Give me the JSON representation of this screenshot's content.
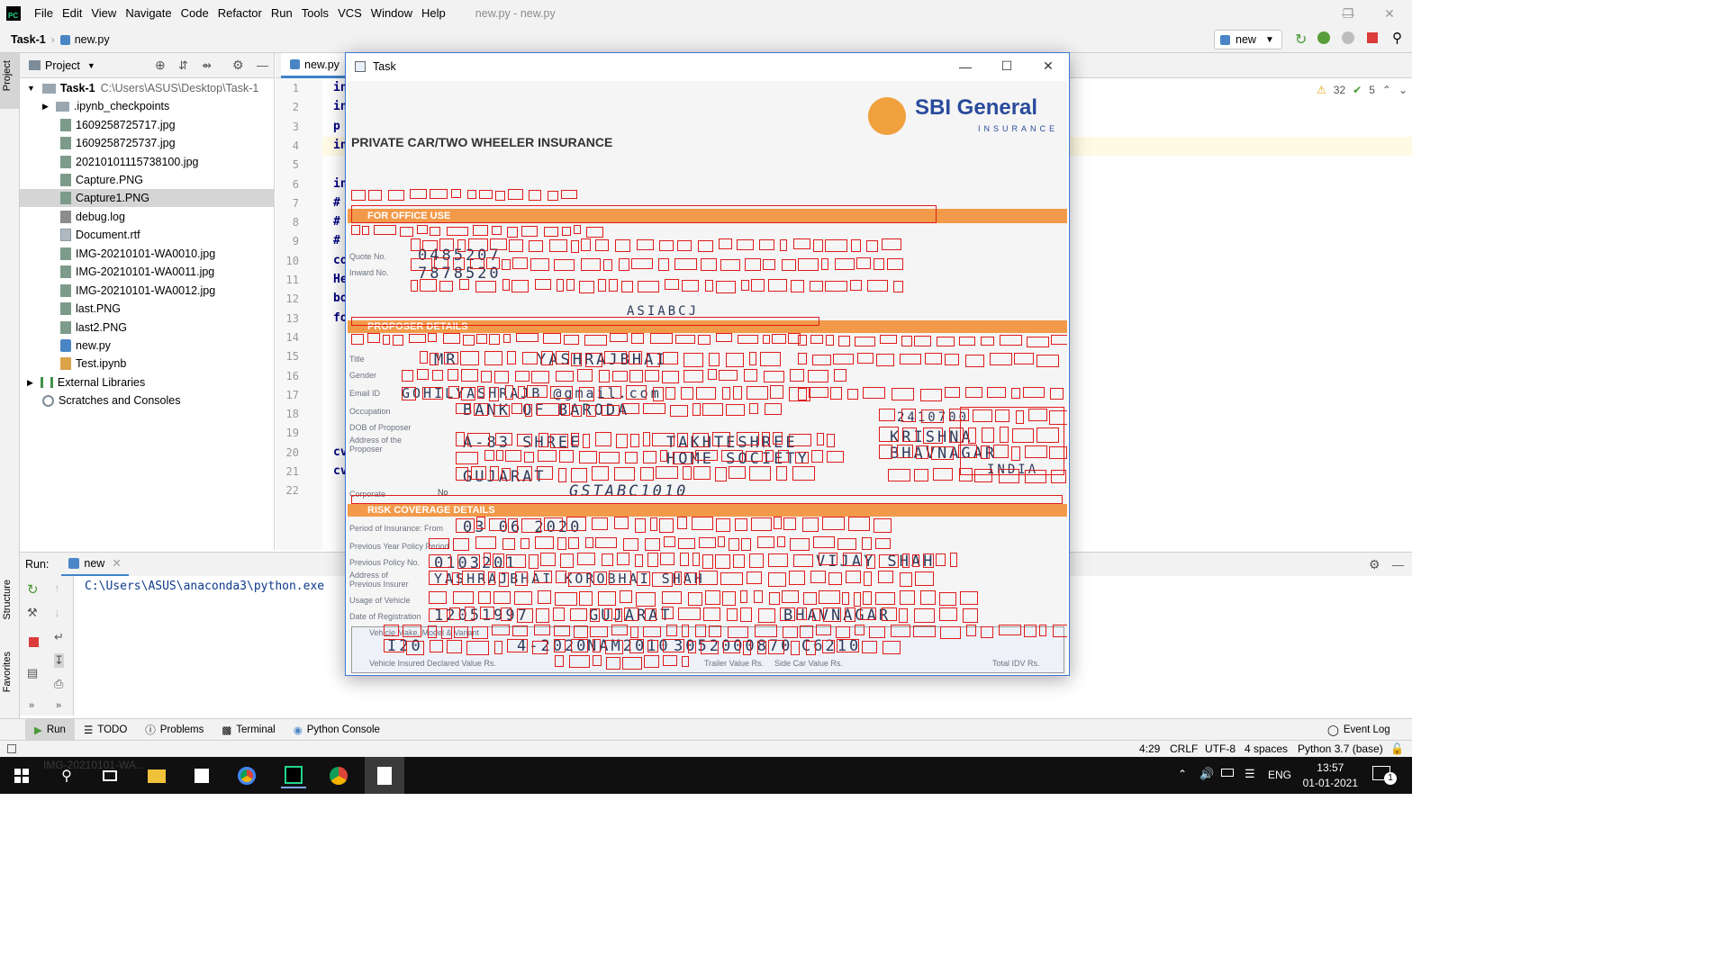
{
  "menubar": {
    "logo_text": "PC",
    "items": [
      "File",
      "Edit",
      "View",
      "Navigate",
      "Code",
      "Refactor",
      "Run",
      "Tools",
      "VCS",
      "Window",
      "Help"
    ],
    "window_title": "new.py - new.py"
  },
  "navbar": {
    "project": "Task-1",
    "file": "new.py",
    "run_config": "new"
  },
  "left_stripe": {
    "project_tab": "Project",
    "structure_tab": "Structure",
    "favorites_tab": "Favorites"
  },
  "project_panel": {
    "title": "Project",
    "root_name": "Task-1",
    "root_path": "C:\\Users\\ASUS\\Desktop\\Task-1",
    "items": [
      {
        "label": ".ipynb_checkpoints",
        "icon": "folder-icon"
      },
      {
        "label": "1609258725717.jpg",
        "icon": "image-file-icon"
      },
      {
        "label": "1609258725737.jpg",
        "icon": "image-file-icon"
      },
      {
        "label": "20210101115738100.jpg",
        "icon": "image-file-icon"
      },
      {
        "label": "Capture.PNG",
        "icon": "image-file-icon"
      },
      {
        "label": "Capture1.PNG",
        "icon": "image-file-icon"
      },
      {
        "label": "debug.log",
        "icon": "log-file-icon"
      },
      {
        "label": "Document.rtf",
        "icon": "document-file-icon"
      },
      {
        "label": "IMG-20210101-WA0010.jpg",
        "icon": "image-file-icon"
      },
      {
        "label": "IMG-20210101-WA0011.jpg",
        "icon": "image-file-icon"
      },
      {
        "label": "IMG-20210101-WA0012.jpg",
        "icon": "image-file-icon"
      },
      {
        "label": "last.PNG",
        "icon": "image-file-icon"
      },
      {
        "label": "last2.PNG",
        "icon": "image-file-icon"
      },
      {
        "label": "new.py",
        "icon": "python-file-icon"
      },
      {
        "label": "Test.ipynb",
        "icon": "notebook-file-icon"
      }
    ],
    "external_libraries": "External Libraries",
    "scratches": "Scratches and Consoles"
  },
  "editor": {
    "tab": "new.py",
    "line_numbers": [
      "1",
      "2",
      "3",
      "4",
      "5",
      "6",
      "7",
      "8",
      "9",
      "10",
      "11",
      "12",
      "13",
      "14",
      "15",
      "16",
      "17",
      "18",
      "19",
      "20",
      "21",
      "22"
    ],
    "visible_code": [
      "in",
      "in",
      "p",
      "in",
      "",
      "in",
      "#",
      "#",
      "#",
      "co",
      "He",
      "bo",
      "fo",
      "",
      "",
      "",
      "",
      "",
      "",
      "cv",
      "cv",
      ""
    ],
    "warnings": "32",
    "weak_warnings": "5"
  },
  "run_panel": {
    "label": "Run:",
    "tab": "new",
    "console_line": "C:\\Users\\ASUS\\anaconda3\\python.exe"
  },
  "bottom_tabs": [
    "Run",
    "TODO",
    "Problems",
    "Terminal",
    "Python Console"
  ],
  "event_log": "Event Log",
  "statusbar": {
    "position": "4:29",
    "line_sep": "CRLF",
    "encoding": "UTF-8",
    "indent": "4 spaces",
    "interpreter": "Python 3.7 (base)"
  },
  "taskbar": {
    "time": "13:57",
    "date": "01-01-2021",
    "language": "ENG",
    "notifications": "1",
    "ghost_label": "IMG-20210101-WA..."
  },
  "task_window": {
    "title": "Task",
    "form": {
      "insurer_logo": "SBI General",
      "insurer_tagline": "INSURANCE",
      "vehicle_type_heading": "PRIVATE CAR/TWO WHEELER INSURANCE",
      "section_office": "FOR OFFICE USE",
      "section_proposer": "PROPOSER DETAILS",
      "section_risk": "RISK COVERAGE DETAILS",
      "quote_no": "0485207",
      "inward_no": "7878520",
      "state": "ASIABCJ",
      "title_value": "MR",
      "name": "YASHRAJBHAI",
      "email": "GOHILYASHRAJB @gmail.com",
      "occupation": "BANK OF BARODA",
      "address": "A-83 SHREE",
      "address_2": "TAKHTESHREE",
      "locality": "HOME SOCIETY",
      "city": "KRISHNA",
      "district": "BHAVNAGAR",
      "state_name": "GUJARAT",
      "country": "INDIA",
      "pincode": "2410700",
      "corporate_no": "No",
      "gstin": "GSTABC1010",
      "period_from": "03 06 2020",
      "previous_policy": "0103201",
      "previous_insurer": "YASHRAJBHAI KOROBHAI SHAH",
      "insurer_name": "VIJAY SHAH",
      "registration_date": "12051997",
      "state_reg": "GUJARAT",
      "location": "BHAVNAGAR",
      "vehicle_model": "I20",
      "year": "4-2020",
      "engine_no": "NAM2010",
      "chassis_no": "3052000870",
      "cc": "C6210",
      "labels": {
        "quote": "Quote No.",
        "inward": "Inward No.",
        "title": "Title",
        "gender": "Gender",
        "email": "Email ID",
        "occupation": "Occupation",
        "dob": "DOB of Proposer",
        "address": "Address of the Proposer",
        "corporate": "Corporate",
        "period": "Period of Insurance: From",
        "prev_year": "Previous Year Policy Period",
        "prev_policy": "Previous Policy No.",
        "prev_address": "Address of Previous Insurer",
        "usage": "Usage of Vehicle",
        "reg_date": "Date of Registration",
        "vehicle_make": "Vehicle Make, Model & Variant",
        "declared_value": "Vehicle Insured Declared Value Rs.",
        "trailer_value": "Trailer Value Rs.",
        "side_car": "Side Car Value Rs.",
        "total_idv": "Total IDV Rs."
      }
    }
  }
}
